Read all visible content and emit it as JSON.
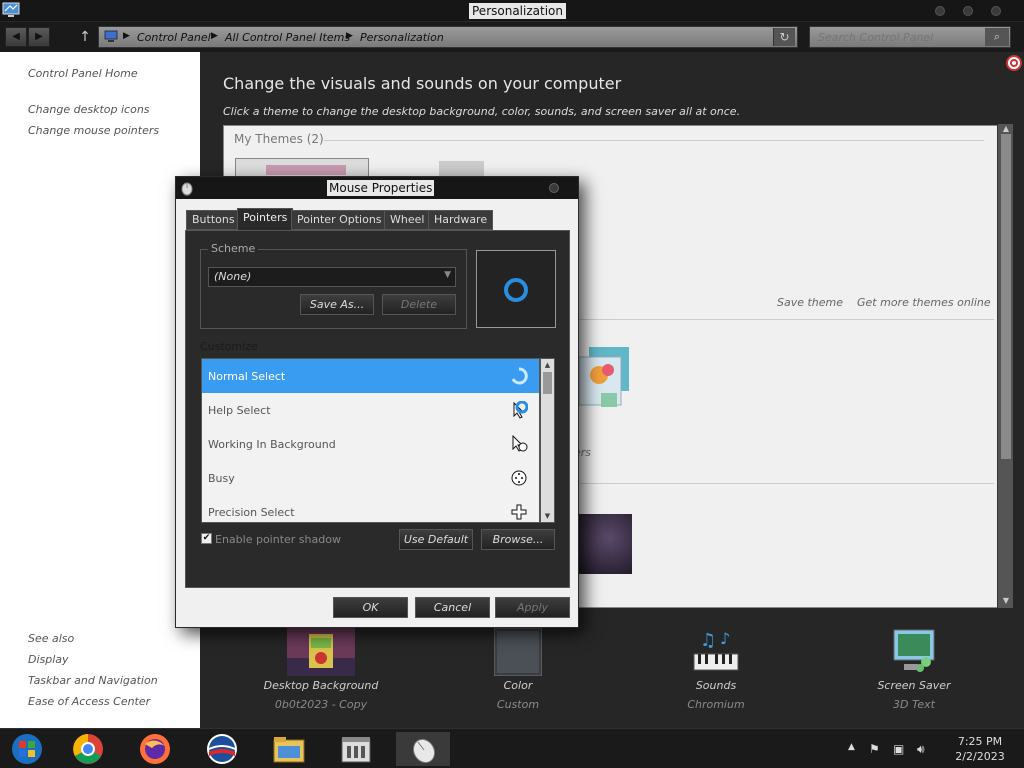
{
  "window": {
    "title": "Personalization"
  },
  "address": {
    "crumbs": [
      "Control Panel",
      "All Control Panel Items",
      "Personalization"
    ],
    "search_placeholder": "Search Control Panel"
  },
  "sidebar": {
    "home": "Control Panel Home",
    "links": [
      "Change desktop icons",
      "Change mouse pointers"
    ],
    "see_also_label": "See also",
    "see_also": [
      "Display",
      "Taskbar and Navigation",
      "Ease of Access Center"
    ]
  },
  "main": {
    "heading": "Change the visuals and sounds on your computer",
    "subheading": "Click a theme to change the desktop background, color, sounds, and screen saver all at once.",
    "my_themes": "My Themes (2)",
    "save_theme": "Save theme",
    "get_more": "Get more themes online",
    "partial_text": "ers"
  },
  "bottom_items": [
    {
      "label": "Desktop Background",
      "sub": "0b0t2023 - Copy"
    },
    {
      "label": "Color",
      "sub": "Custom"
    },
    {
      "label": "Sounds",
      "sub": "Chromium"
    },
    {
      "label": "Screen Saver",
      "sub": "3D Text"
    }
  ],
  "dialog": {
    "title": "Mouse Properties",
    "tabs": [
      "Buttons",
      "Pointers",
      "Pointer Options",
      "Wheel",
      "Hardware"
    ],
    "active_tab": "Pointers",
    "scheme_label": "Scheme",
    "scheme_value": "(None)",
    "save_as": "Save As...",
    "delete": "Delete",
    "customize_label": "Customize",
    "cursors": [
      "Normal Select",
      "Help Select",
      "Working In Background",
      "Busy",
      "Precision Select"
    ],
    "selected_cursor": "Normal Select",
    "shadow_label": "Enable pointer shadow",
    "shadow_checked": true,
    "use_default": "Use Default",
    "browse": "Browse...",
    "ok": "OK",
    "cancel": "Cancel",
    "apply": "Apply"
  },
  "taskbar": {
    "apps": [
      "start-icon",
      "chrome-icon",
      "firefox-icon",
      "obama-logo-icon",
      "file-explorer-icon",
      "store-icon",
      "mouse-icon"
    ],
    "time": "7:25 PM",
    "date": "2/2/2023"
  },
  "colors": {
    "selection": "#3a9cf0",
    "dark_bg": "#262626",
    "titlebar": "#161616"
  }
}
